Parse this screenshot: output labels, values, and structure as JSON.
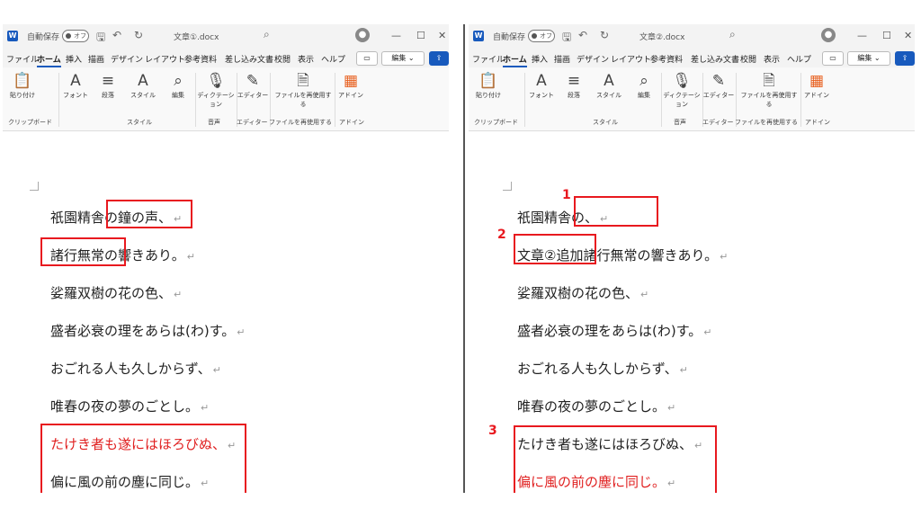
{
  "left": {
    "autosave": "自動保存",
    "autosave_state": "オフ",
    "doc_title": "文章①.docx",
    "menu": [
      "ファイル",
      "ホーム",
      "挿入",
      "描画",
      "デザイン",
      "レイアウト",
      "参考資料",
      "差し込み文書",
      "校閲",
      "表示",
      "ヘルプ"
    ],
    "edit_label": "編集",
    "lines": [
      "祇園精舎の鐘の声、",
      "諸行無常の響きあり。",
      "娑羅双樹の花の色、",
      "盛者必衰の理をあらは(わ)す。",
      "おごれる人も久しからず、",
      "唯春の夜の夢のごとし。",
      "たけき者も遂にはほろびぬ、",
      "偏に風の前の塵に同じ。"
    ]
  },
  "right": {
    "autosave": "自動保存",
    "autosave_state": "オフ",
    "doc_title": "文章②.docx",
    "menu": [
      "ファイル",
      "ホーム",
      "挿入",
      "描画",
      "デザイン",
      "レイアウト",
      "参考資料",
      "差し込み文書",
      "校閲",
      "表示",
      "ヘルプ"
    ],
    "edit_label": "編集",
    "lines": [
      "祇園精舎の、",
      "文章②追加",
      "諸行無常の響きあり。",
      "娑羅双樹の花の色、",
      "盛者必衰の理をあらは(わ)す。",
      "おごれる人も久しからず、",
      "唯春の夜の夢のごとし。",
      "たけき者も遂にはほろびぬ、",
      "偏に風の前の塵に同じ。"
    ]
  },
  "ribbon": {
    "paste": "貼り付け",
    "font": "フォント",
    "paragraph": "段落",
    "style": "スタイル",
    "edit": "編集",
    "dictation": "ディクテーション",
    "editor": "エディター",
    "reuse": "ファイルを再使用する",
    "addin": "アドイン",
    "g_clipboard": "クリップボード",
    "g_style": "スタイル",
    "g_voice": "音声",
    "g_editor": "エディター",
    "g_reuse": "ファイルを再使用する",
    "g_addin": "アドイン"
  },
  "annotations": [
    "1",
    "2",
    "3"
  ],
  "colors": {
    "highlight_box": "#e8191f",
    "changed_text": "#e02020",
    "word_blue": "#185abd"
  },
  "icons": [
    "word-logo-icon",
    "save-icon",
    "undo-icon",
    "redo-icon",
    "search-icon",
    "avatar-icon",
    "minimize-icon",
    "maximize-icon",
    "close-icon",
    "comment-icon",
    "share-icon",
    "paste-icon",
    "font-icon",
    "paragraph-icon",
    "style-icon",
    "find-icon",
    "microphone-icon",
    "editor-icon",
    "reuse-file-icon",
    "addin-icon"
  ]
}
